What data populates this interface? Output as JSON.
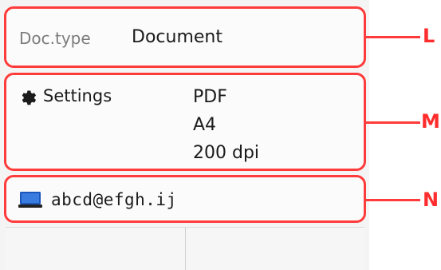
{
  "document_type": {
    "label": "Doc.type",
    "value": "Document"
  },
  "settings": {
    "label": "Settings",
    "values": [
      "PDF",
      "A4",
      "200 dpi"
    ],
    "icon": "gear-icon"
  },
  "destination": {
    "value": "abcd@efgh.ij",
    "icon": "computer-icon"
  },
  "callouts": {
    "L": "L",
    "M": "M",
    "N": "N"
  },
  "colors": {
    "callout": "#ff3b3b"
  }
}
